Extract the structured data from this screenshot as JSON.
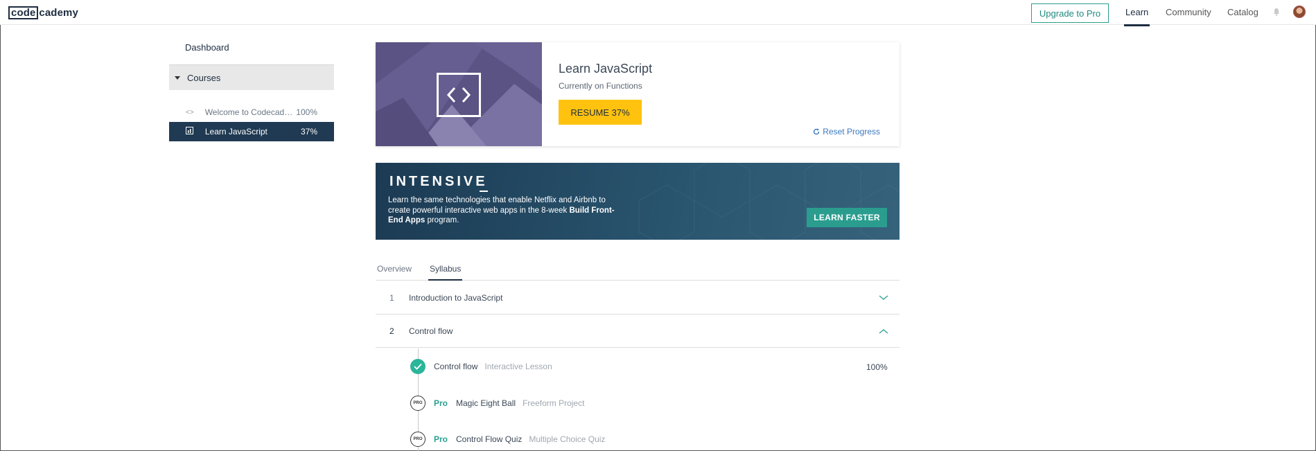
{
  "nav": {
    "logo_box": "code",
    "logo_rest": "cademy",
    "upgrade_label": "Upgrade to Pro",
    "links": [
      "Learn",
      "Community",
      "Catalog"
    ]
  },
  "sidebar": {
    "dashboard": "Dashboard",
    "courses": "Courses",
    "items": [
      {
        "label": "Welcome to Codecademy!",
        "pct": "100%"
      },
      {
        "label": "Learn JavaScript",
        "pct": "37%"
      }
    ]
  },
  "course": {
    "title": "Learn JavaScript",
    "subtitle": "Currently on Functions",
    "resume_label": "RESUME 37%",
    "reset_label": "Reset Progress",
    "progress": 37
  },
  "banner": {
    "title": "INTENSIVE",
    "text_1": "Learn the same technologies that enable Netflix and Airbnb to create powerful interactive web apps in the 8-week ",
    "text_bold": "Build Front-End Apps",
    "text_2": " program.",
    "cta": "LEARN FASTER"
  },
  "tabs": [
    "Overview",
    "Syllabus"
  ],
  "syllabus": {
    "units": [
      {
        "num": "1",
        "title": "Introduction to JavaScript"
      },
      {
        "num": "2",
        "title": "Control flow"
      }
    ],
    "lessons": [
      {
        "pro": "",
        "name": "Control flow",
        "kind": "Interactive Lesson",
        "pct": "100%"
      },
      {
        "pro": "Pro",
        "name": "Magic Eight Ball",
        "kind": "Freeform Project"
      },
      {
        "pro": "Pro",
        "name": "Control Flow Quiz",
        "kind": "Multiple Choice Quiz"
      }
    ]
  },
  "colors": {
    "brand_navy": "#1d2c40",
    "teal": "#2a9d8f",
    "resume_yellow": "#ffc20e",
    "link_blue": "#3a78c0"
  },
  "icons": [
    "code-icon",
    "bell-icon",
    "refresh-icon",
    "check-icon",
    "pro-badge-icon",
    "chevron-down-icon",
    "chevron-up-icon",
    "caret-down-icon"
  ]
}
